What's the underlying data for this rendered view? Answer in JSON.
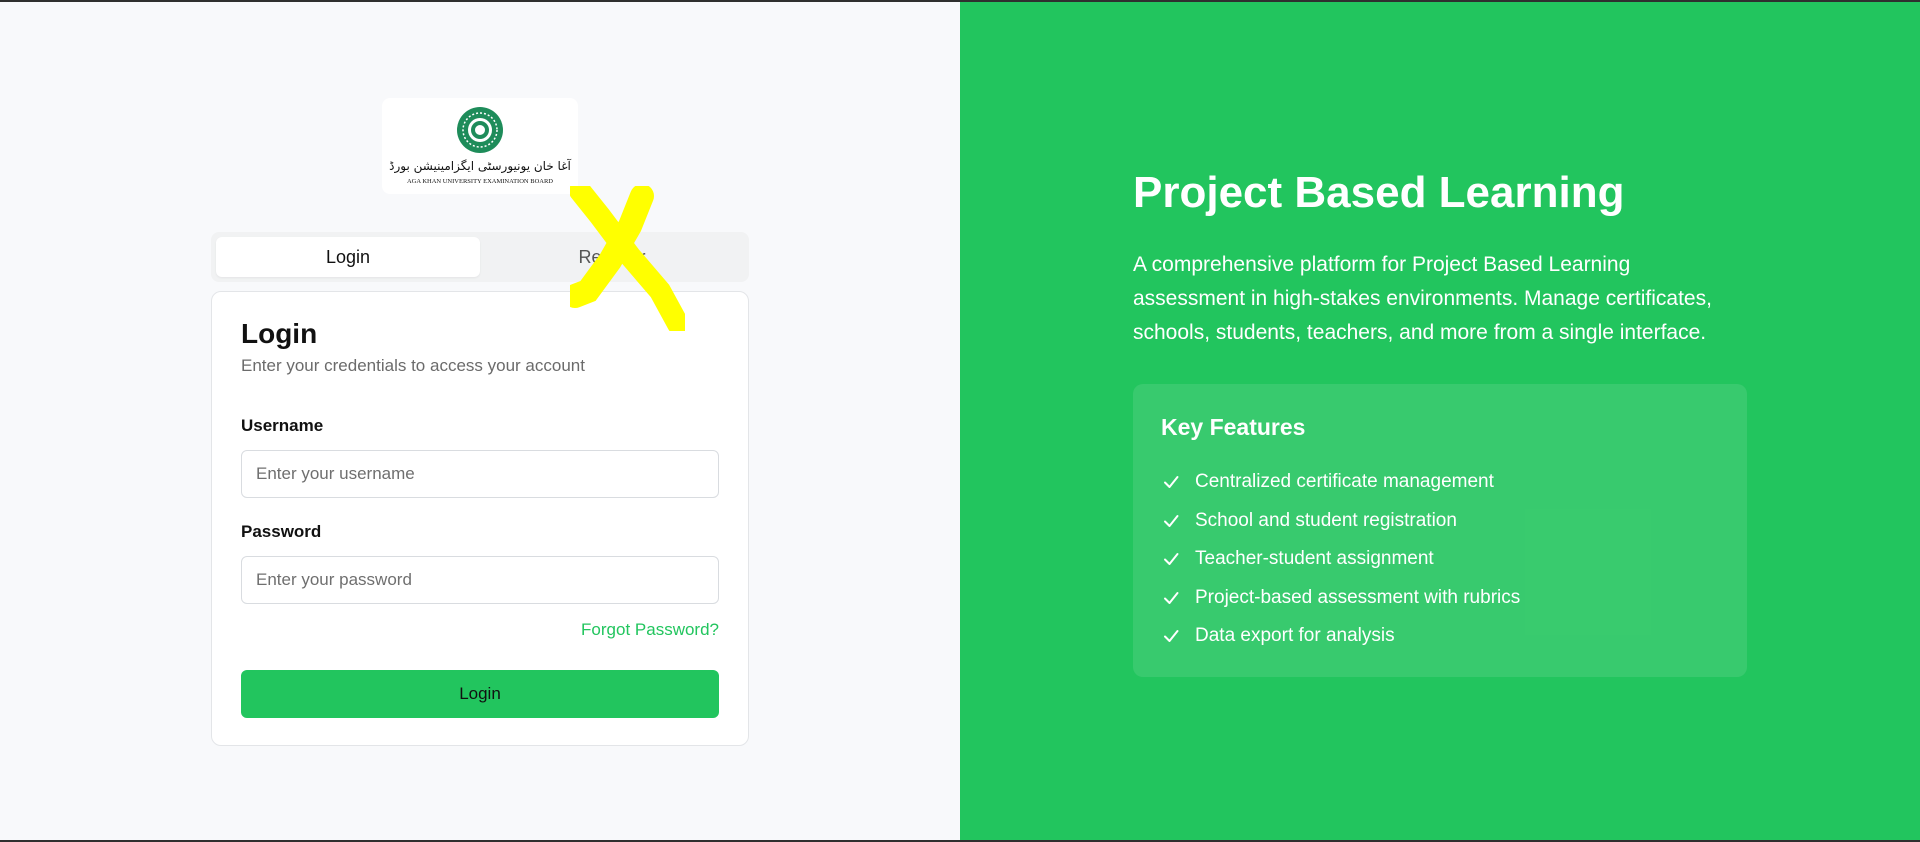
{
  "logo": {
    "urdu_text": "آغا خان یونیورسٹی ایگزامینیشن بورڈ",
    "english_text": "AGA KHAN UNIVERSITY EXAMINATION BOARD"
  },
  "tabs": [
    {
      "label": "Login",
      "active": true
    },
    {
      "label": "Register",
      "active": false
    }
  ],
  "login_card": {
    "title": "Login",
    "subtitle": "Enter your credentials to access your account",
    "username_label": "Username",
    "username_placeholder": "Enter your username",
    "password_label": "Password",
    "password_placeholder": "Enter your password",
    "forgot_link": "Forgot Password?",
    "submit_label": "Login"
  },
  "hero": {
    "title": "Project Based Learning",
    "description": "A comprehensive platform for Project Based Learning assessment in high-stakes environments. Manage certificates, schools, students, teachers, and more from a single interface."
  },
  "features": {
    "title": "Key Features",
    "items": [
      "Centralized certificate management",
      "School and student registration",
      "Teacher-student assignment",
      "Project-based assessment with rubrics",
      "Data export for analysis"
    ]
  },
  "colors": {
    "brand_green": "#22c55e",
    "left_bg": "#f8f9fb",
    "annotation_yellow": "#ffff00",
    "logo_green": "#1e8c5a"
  },
  "icons": {
    "feature_bullet": "check-icon",
    "logo_emblem": "emblem-icon"
  }
}
